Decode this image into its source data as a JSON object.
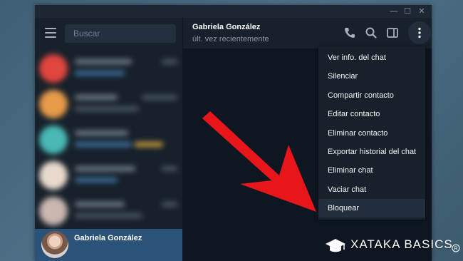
{
  "window": {
    "minimize_glyph": "—",
    "maximize_glyph": "☐",
    "close_glyph": "✕"
  },
  "sidebar": {
    "search_placeholder": "Buscar",
    "active_chat": {
      "name": "Gabriela González"
    }
  },
  "header": {
    "contact_name": "Gabriela González",
    "status": "últ. vez recientemente",
    "icons": [
      "phone-icon",
      "search-icon",
      "sidebar-toggle-icon",
      "more-vertical-icon"
    ]
  },
  "menu": {
    "items": [
      "Ver info. del chat",
      "Silenciar",
      "Compartir contacto",
      "Editar contacto",
      "Eliminar contacto",
      "Exportar historial del chat",
      "Eliminar chat",
      "Vaciar chat",
      "Bloquear"
    ],
    "highlighted_item": "Bloquear"
  },
  "watermark": {
    "text": "XATAKA BASICS"
  },
  "colors": {
    "arrow": "#e8161b",
    "accent": "#2b5278",
    "background": "#17212b"
  }
}
